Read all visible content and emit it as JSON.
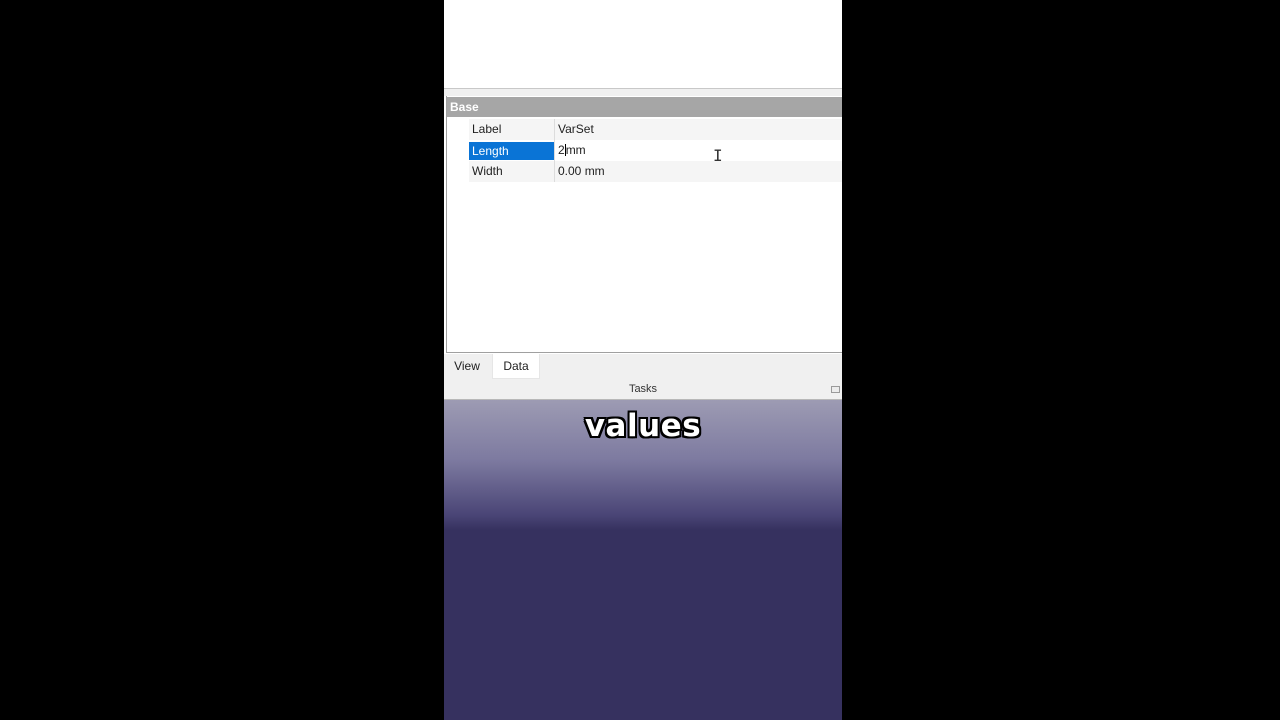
{
  "property_editor": {
    "group_header": "Base",
    "rows": [
      {
        "name": "Label",
        "value": "VarSet"
      },
      {
        "name": "Length",
        "value_before_caret": "2",
        "value_after_caret": "mm"
      },
      {
        "name": "Width",
        "value": "0.00 mm"
      }
    ]
  },
  "tabs": {
    "view": "View",
    "data": "Data",
    "active": "Data"
  },
  "tasks_panel": {
    "title": "Tasks"
  },
  "overlay": {
    "caption": "values"
  },
  "colors": {
    "selection": "#0a74d6",
    "group_header_bg": "#a6a6a6",
    "viewport_bottom": "#36315f"
  }
}
